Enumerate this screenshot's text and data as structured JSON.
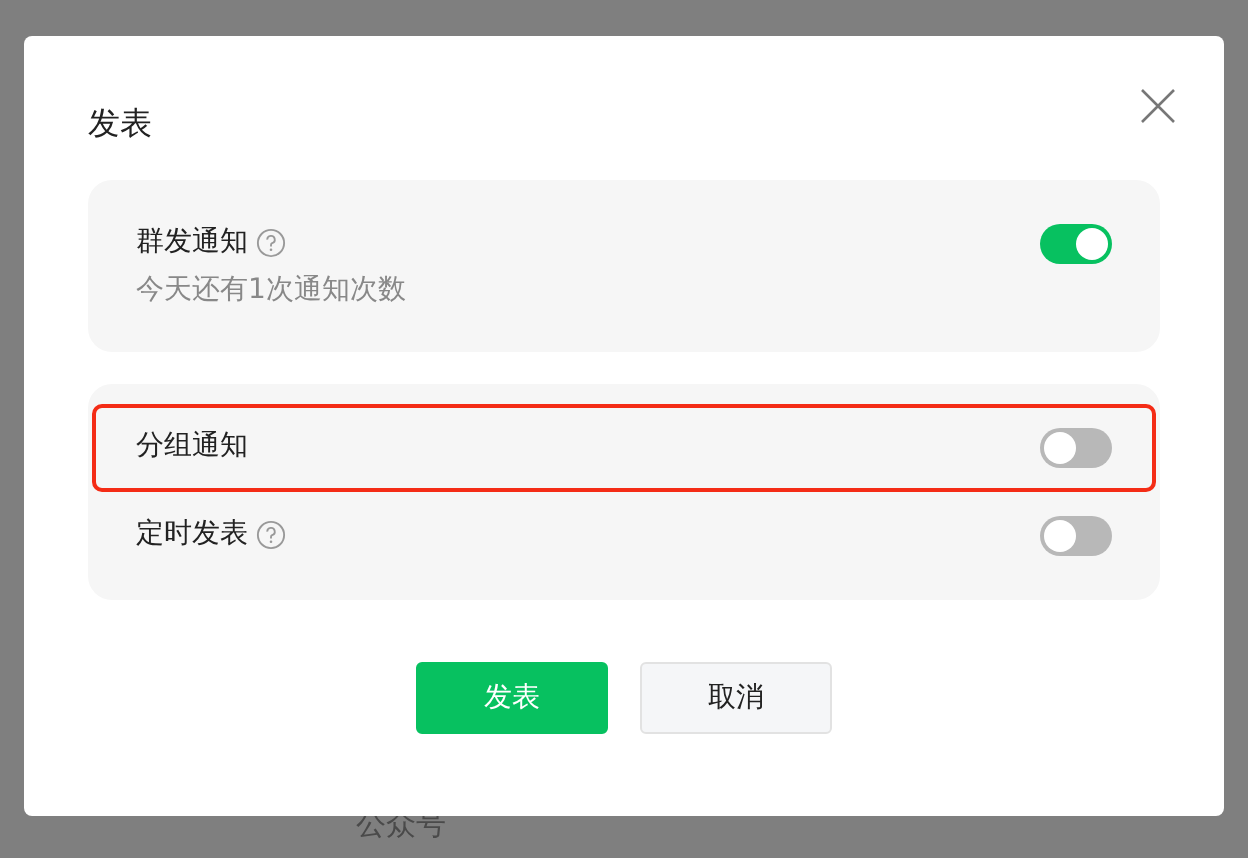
{
  "background": {
    "texts": [
      "公众号"
    ]
  },
  "dialog": {
    "title": "发表",
    "cards": [
      {
        "rows": [
          {
            "label": "群发通知",
            "help": true,
            "note": "今天还有1次通知次数",
            "on": true,
            "highlighted": false
          }
        ]
      },
      {
        "rows": [
          {
            "label": "分组通知",
            "help": false,
            "on": false,
            "highlighted": true
          },
          {
            "label": "定时发表",
            "help": true,
            "on": false,
            "highlighted": false
          }
        ]
      }
    ],
    "buttons": [
      {
        "label": "发表",
        "kind": "primary"
      },
      {
        "label": "取消",
        "kind": "secondary"
      }
    ]
  }
}
